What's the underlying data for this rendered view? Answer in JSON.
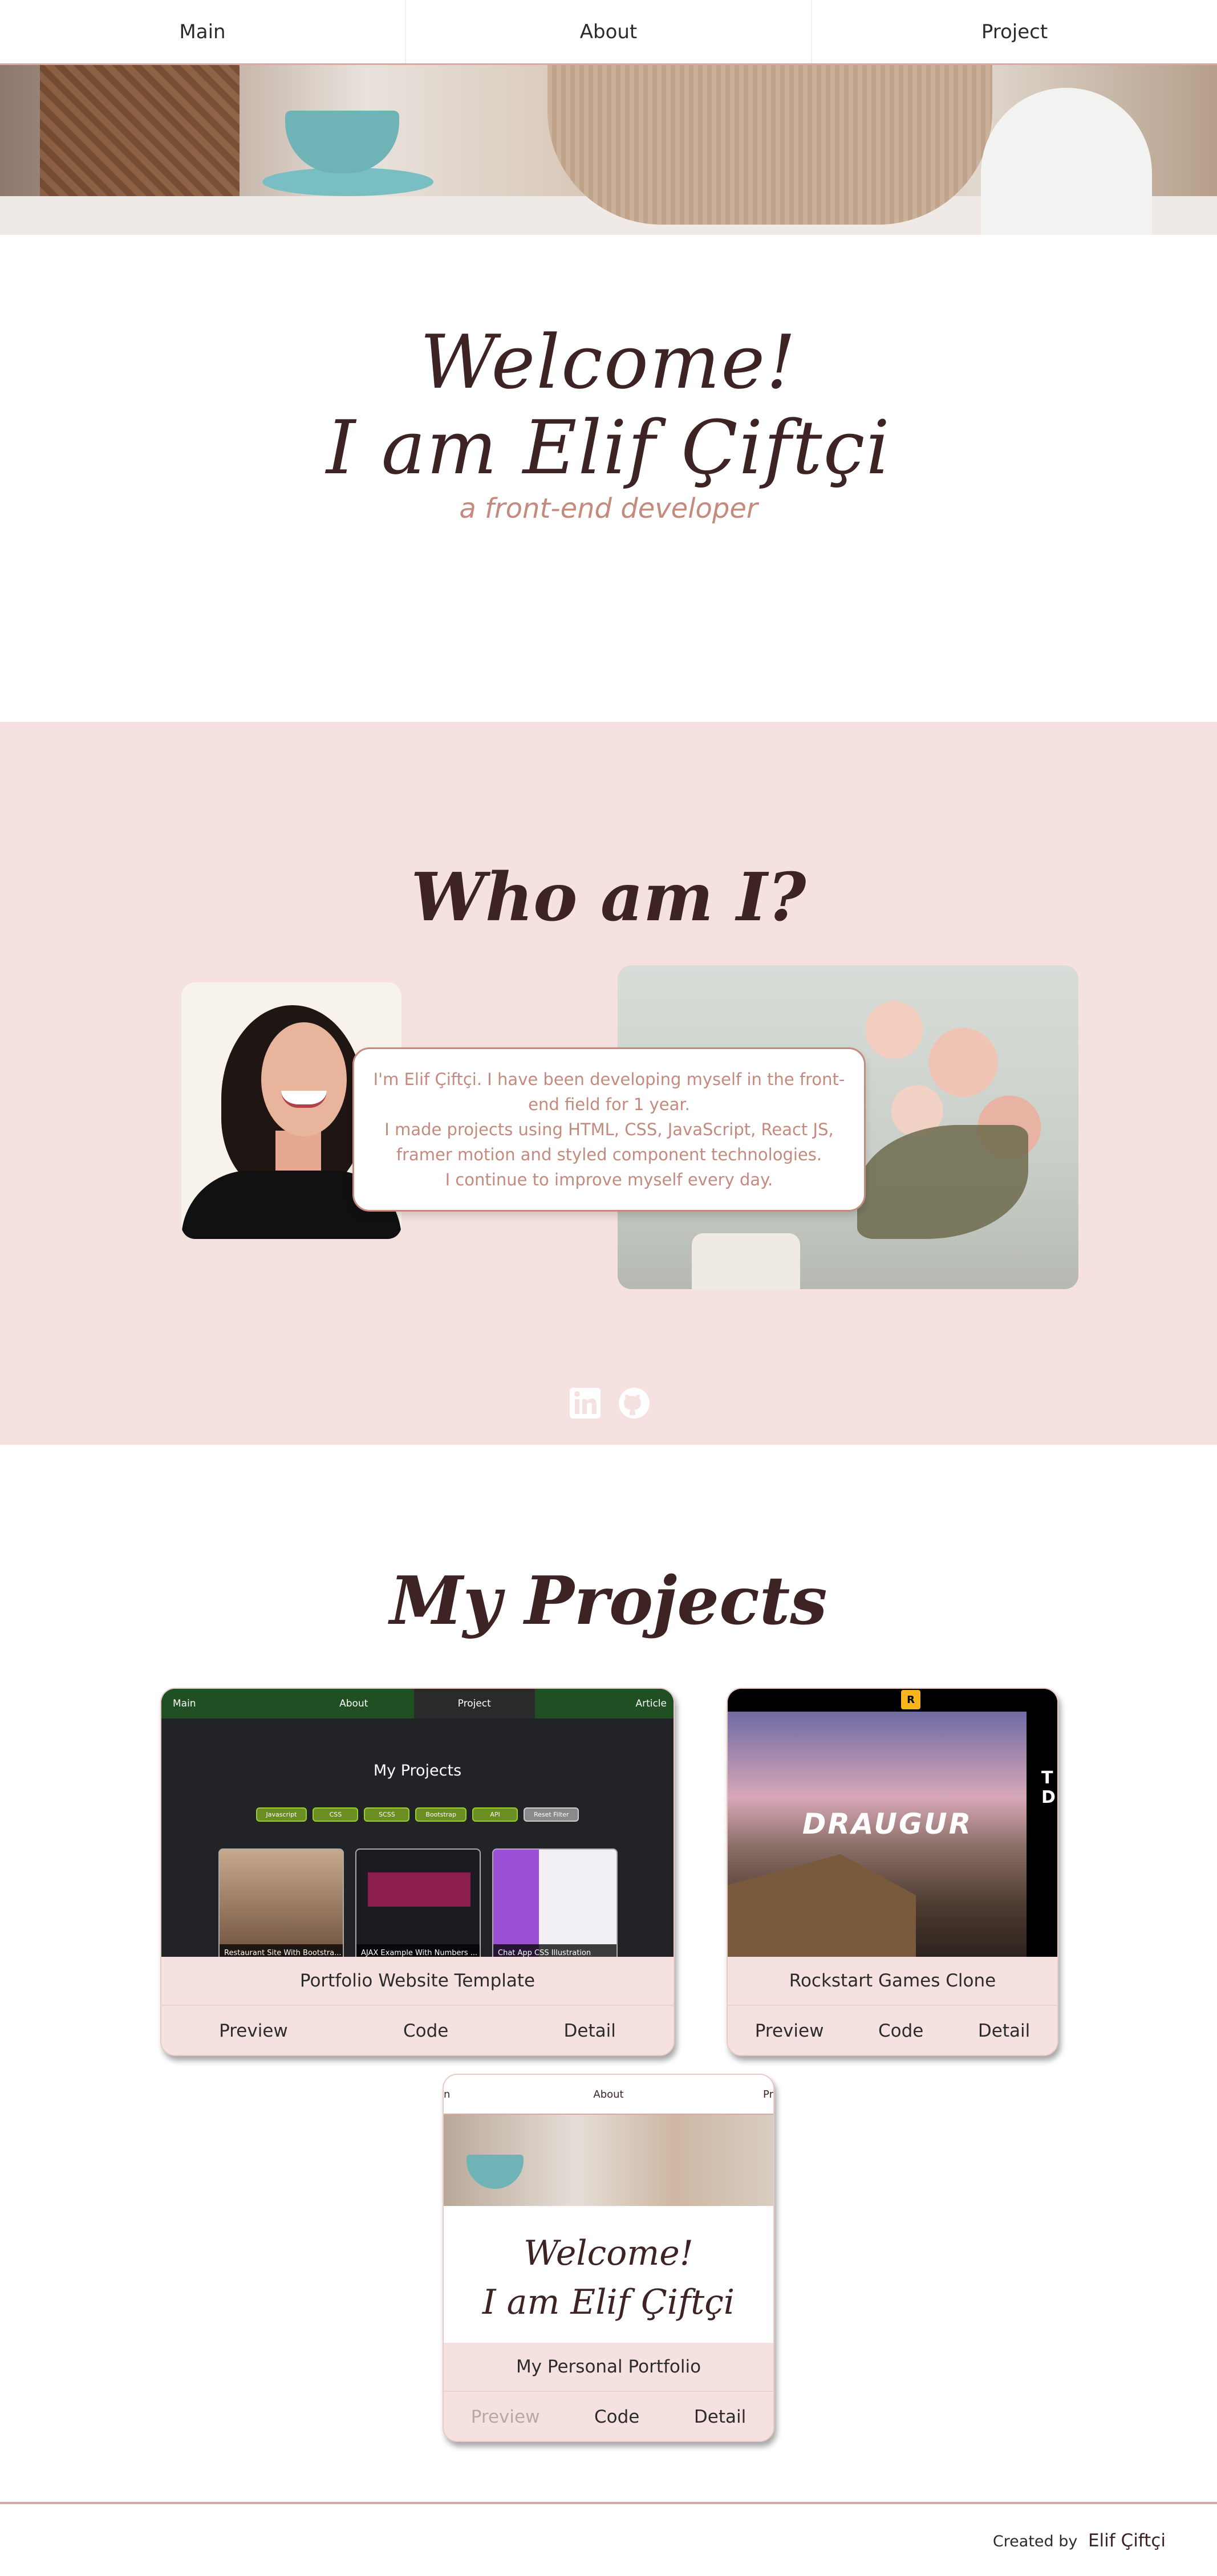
{
  "nav": {
    "items": [
      "Main",
      "About",
      "Project"
    ]
  },
  "hero": {
    "line1": "Welcome!",
    "line2": "I am Elif Çiftçi",
    "subtitle": "a front-end developer"
  },
  "about": {
    "title": "Who am I?",
    "bio": [
      "I'm Elif Çiftçi. I have been developing myself in the front-",
      "end field for 1 year.",
      "I made projects using HTML, CSS, JavaScript, React JS,",
      "framer motion and styled component technologies.",
      "I continue to improve myself every day."
    ],
    "socials": [
      "linkedin-icon",
      "github-icon"
    ]
  },
  "projects": {
    "title": "My Projects",
    "cards": [
      {
        "name": "Portfolio Website Template",
        "actions": [
          "Preview",
          "Code",
          "Detail"
        ],
        "shot": {
          "nav": [
            "Main",
            "About",
            "Project",
            "Article"
          ],
          "title": "My Projects",
          "pills": [
            "Javascript",
            "CSS",
            "SCSS",
            "Bootstrap",
            "API",
            "Reset Filter"
          ],
          "items": [
            "Restaurant Site With Bootstra...",
            "AJAX Example With Numbers ...",
            "Chat App CSS Illustration"
          ]
        }
      },
      {
        "name": "Rockstart Games Clone",
        "actions": [
          "Preview",
          "Code",
          "Detail"
        ],
        "shot": {
          "badge": "R",
          "logo": "DRAUGUR",
          "side": "T D"
        }
      },
      {
        "name": "My Personal Portfolio",
        "actions": [
          "Preview",
          "Code",
          "Detail"
        ],
        "shot": {
          "nav": [
            "n",
            "About",
            "Pr"
          ],
          "line1": "Welcome!",
          "line2": "I am Elif Çiftçi"
        }
      }
    ]
  },
  "footer": {
    "prefix": "Created by",
    "author": "Elif Çiftçi"
  },
  "colors": {
    "accent": "#c48a7d",
    "dark": "#3d2323",
    "blush": "#f5e2e0"
  }
}
